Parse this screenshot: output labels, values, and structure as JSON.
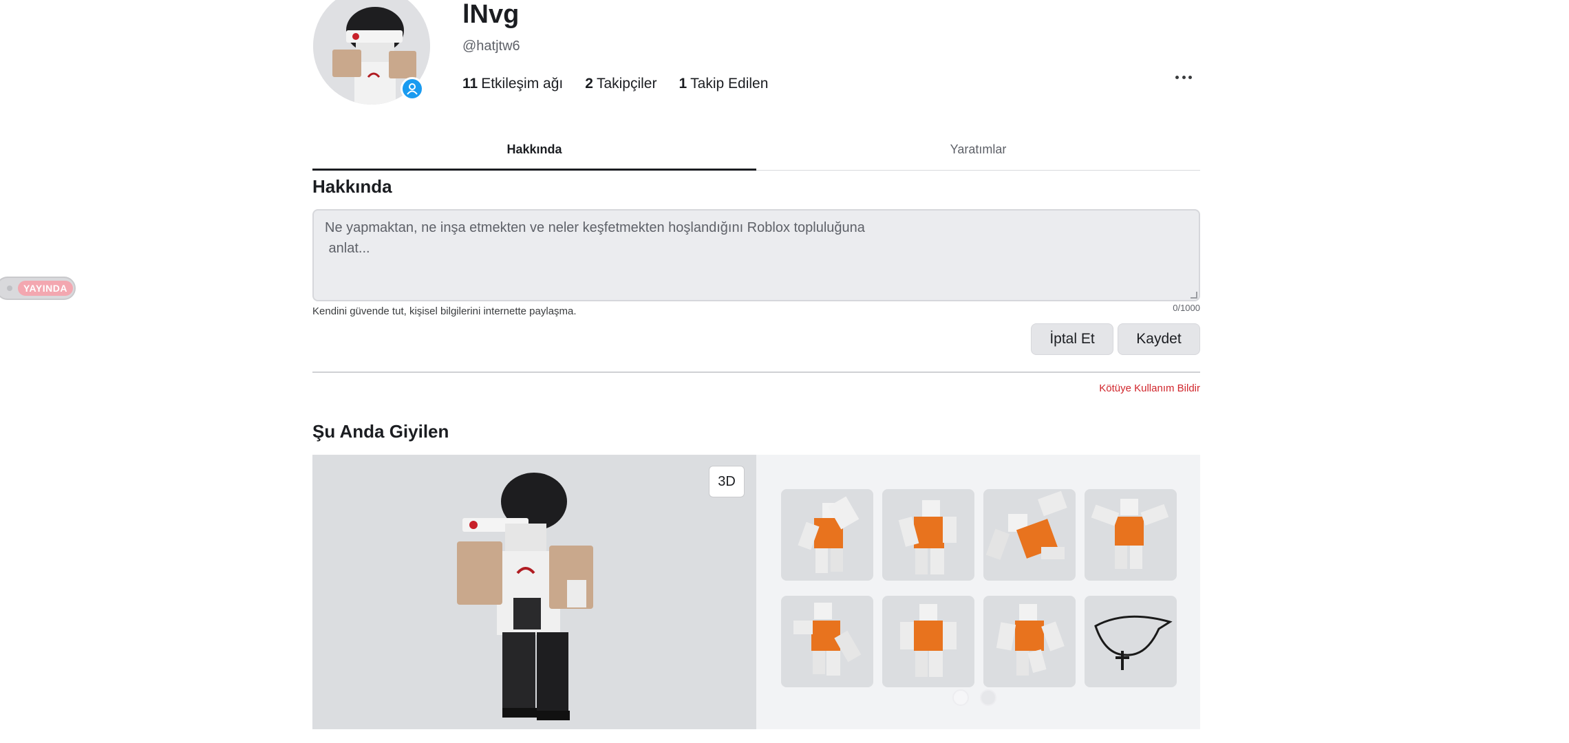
{
  "live_badge": {
    "label": "YAYINDA"
  },
  "profile": {
    "display_name": "lNvg",
    "username": "@hatjtw6",
    "stats": [
      {
        "count": "11",
        "label": "Etkileşim ağı"
      },
      {
        "count": "2",
        "label": "Takipçiler"
      },
      {
        "count": "1",
        "label": "Takip Edilen"
      }
    ]
  },
  "tabs": [
    {
      "label": "Hakkında",
      "active": true
    },
    {
      "label": "Yaratımlar",
      "active": false
    }
  ],
  "about": {
    "title": "Hakkında",
    "placeholder_line1": "Ne yapmaktan, ne inşa etmekten ve neler keşfetmekten hoşlandığını Roblox topluluğuna",
    "placeholder_line2": " anlat...",
    "counter": "0/1000",
    "safety_note": "Kendini güvende tut, kişisel bilgilerini internette paylaşma.",
    "cancel_label": "İptal Et",
    "save_label": "Kaydet",
    "report_label": "Kötüye Kullanım Bildir"
  },
  "wearing": {
    "title": "Şu Anda Giyilen",
    "view_toggle": "3D",
    "items": [
      {
        "icon": "orange-avatar-emote-icon"
      },
      {
        "icon": "orange-avatar-emote-icon"
      },
      {
        "icon": "orange-avatar-emote-icon"
      },
      {
        "icon": "orange-avatar-emote-icon"
      },
      {
        "icon": "orange-avatar-emote-icon"
      },
      {
        "icon": "orange-avatar-emote-icon"
      },
      {
        "icon": "orange-avatar-emote-icon"
      },
      {
        "icon": "cross-necklace-icon"
      }
    ],
    "pages": 2,
    "current_page": 1
  },
  "colors": {
    "accent_blue": "#1a9bf0",
    "report_red": "#d1262c",
    "live_pink": "#f3a7b0",
    "item_orange": "#e8731e"
  }
}
